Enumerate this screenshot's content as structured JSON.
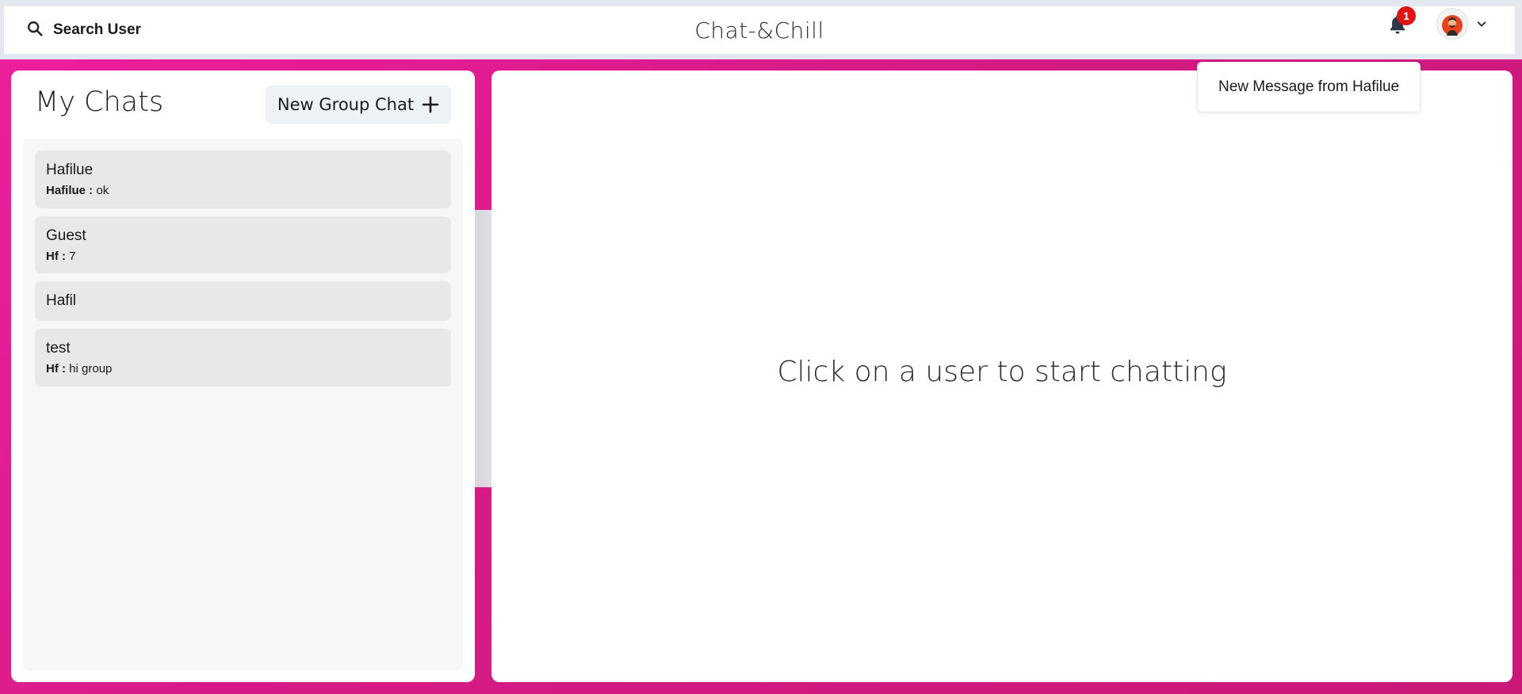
{
  "header": {
    "search_label": "Search User",
    "app_title": "Chat-&Chill",
    "notification_count": "1",
    "icons": {
      "search": "search-icon",
      "bell": "bell-icon",
      "avatar": "avatar",
      "chevron": "chevron-down-icon"
    }
  },
  "notifications": {
    "items": [
      {
        "text": "New Message from Hafilue"
      }
    ]
  },
  "sidebar": {
    "title": "My Chats",
    "new_group_label": "New Group Chat",
    "chats": [
      {
        "name": "Hafilue",
        "sender": "Hafilue :",
        "message": "ok"
      },
      {
        "name": "Guest",
        "sender": "Hf :",
        "message": "7"
      },
      {
        "name": "Hafil",
        "sender": "",
        "message": ""
      },
      {
        "name": "test",
        "sender": "Hf :",
        "message": "hi group"
      }
    ]
  },
  "main": {
    "placeholder": "Click on a user to start chatting"
  },
  "colors": {
    "background_accent": "#e11d93",
    "badge": "#e01414",
    "chat_item_bg": "#e8e8e8",
    "button_bg": "#edf2f7"
  }
}
